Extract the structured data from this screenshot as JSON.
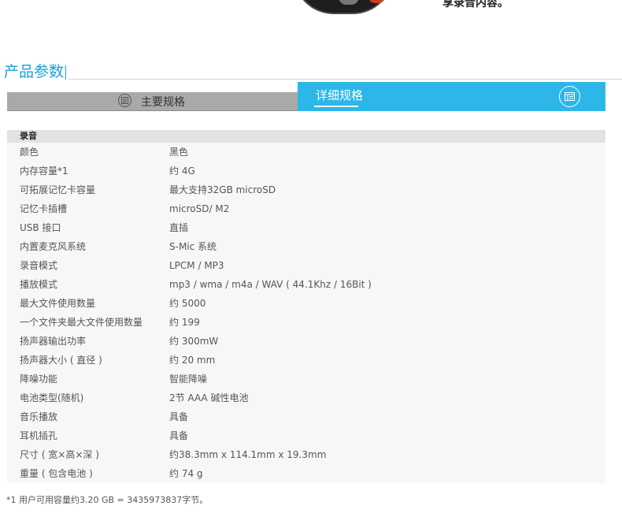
{
  "banner": {
    "caption": "享录音内容。"
  },
  "section": {
    "title": "产品参数"
  },
  "tabs": [
    {
      "label": "主要规格",
      "icon": "document-list-icon",
      "active": false
    },
    {
      "label": "详细规格",
      "icon": "spec-sheet-icon",
      "active": true
    }
  ],
  "spec": {
    "group_title": "录音",
    "rows": [
      {
        "key": "颜色",
        "value": "黑色"
      },
      {
        "key": "内存容量*1",
        "value": "约 4G"
      },
      {
        "key": "可拓展记忆卡容量",
        "value": "最大支持32GB microSD"
      },
      {
        "key": "记忆卡插槽",
        "value": "microSD/ M2"
      },
      {
        "key": "USB 接口",
        "value": "直插"
      },
      {
        "key": "内置麦克风系统",
        "value": "S-Mic 系统"
      },
      {
        "key": "录音模式",
        "value": "LPCM / MP3"
      },
      {
        "key": "播放模式",
        "value": "mp3 / wma / m4a / WAV ( 44.1Khz / 16Bit )"
      },
      {
        "key": "最大文件使用数量",
        "value": "约 5000"
      },
      {
        "key": "一个文件夹最大文件使用数量",
        "value": "约 199"
      },
      {
        "key": "扬声器输出功率",
        "value": "约 300mW"
      },
      {
        "key": "扬声器大小 ( 直径 )",
        "value": "约 20 mm"
      },
      {
        "key": "降噪功能",
        "value": "智能降噪"
      },
      {
        "key": "电池类型(随机)",
        "value": "2节 AAA 碱性电池"
      },
      {
        "key": "音乐播放",
        "value": "具备"
      },
      {
        "key": "耳机插孔",
        "value": "具备"
      },
      {
        "key": "尺寸 ( 宽×高×深 )",
        "value": "约38.3mm x 114.1mm x 19.3mm"
      },
      {
        "key": "重量 ( 包含电池 )",
        "value": "约 74 g"
      }
    ]
  },
  "footnote": "*1 用户可用容量约3.20 GB = 3435973837字节。",
  "colors": {
    "accent": "#2cb7e8",
    "title": "#1aa0d8",
    "tab_inactive": "#a9a9a9"
  }
}
